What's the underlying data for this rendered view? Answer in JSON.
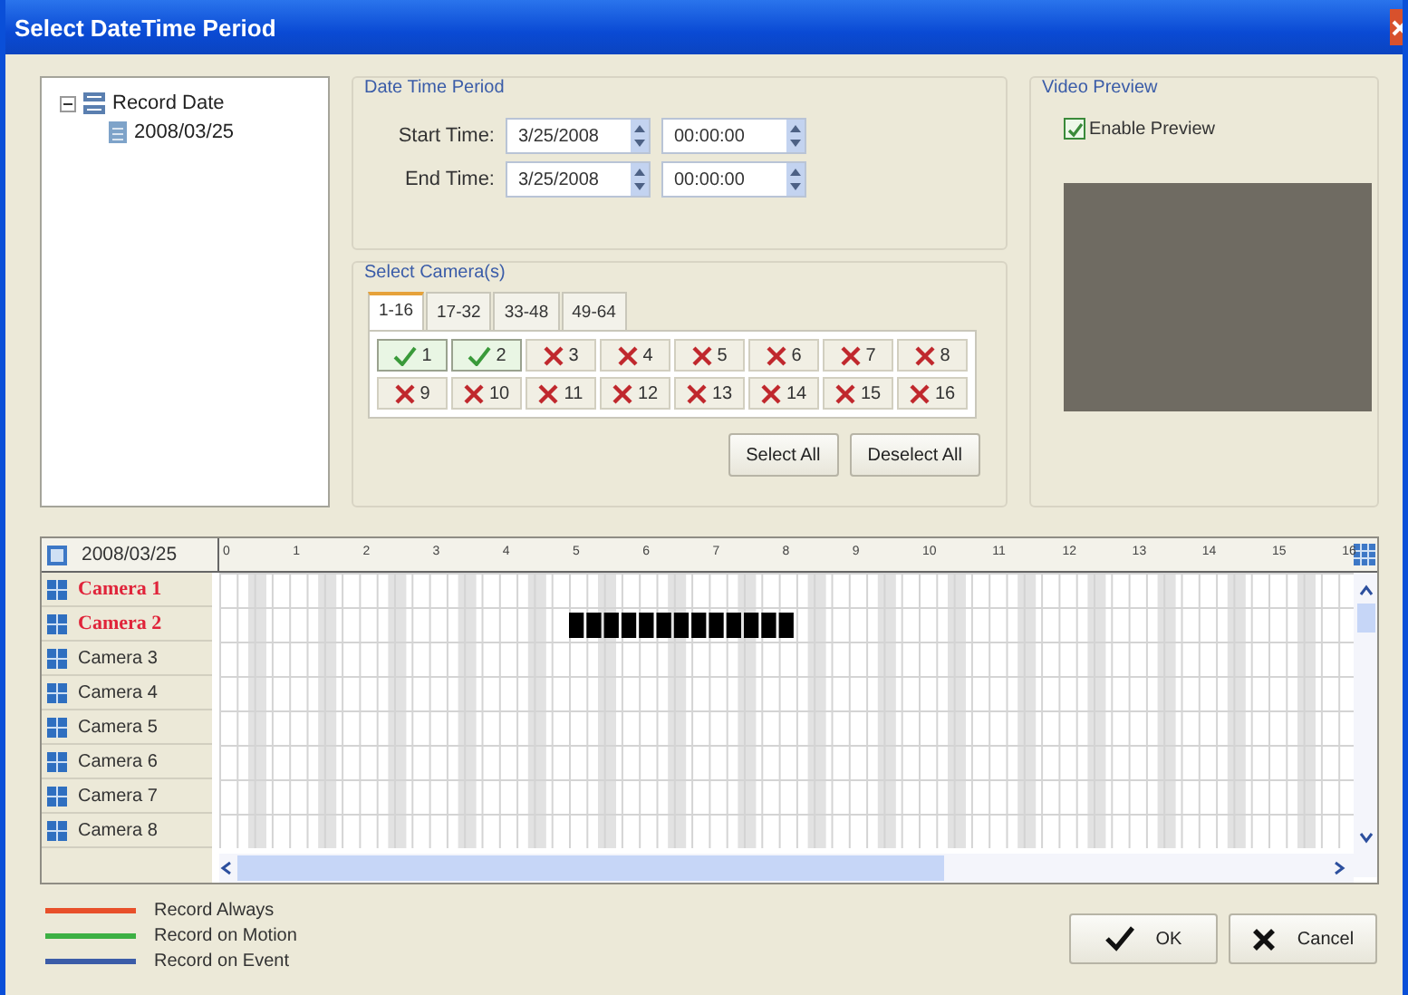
{
  "window": {
    "title": "Select DateTime Period"
  },
  "tree": {
    "label": "Record Date",
    "expanded": true,
    "children": [
      {
        "label": "2008/03/25"
      }
    ]
  },
  "date_time_period": {
    "title": "Date Time Period",
    "rows": [
      {
        "label": "Start Time:",
        "date": "3/25/2008",
        "time": "00:00:00"
      },
      {
        "label": "End Time:",
        "date": "3/25/2008",
        "time": "00:00:00"
      }
    ]
  },
  "camera_select": {
    "title": "Select Camera(s)",
    "tabs": [
      {
        "label": "1-16",
        "selected": true
      },
      {
        "label": "17-32",
        "selected": false
      },
      {
        "label": "33-48",
        "selected": false
      },
      {
        "label": "49-64",
        "selected": false
      }
    ],
    "cameras": [
      {
        "label": "1",
        "checked": true
      },
      {
        "label": "2",
        "checked": true
      },
      {
        "label": "3",
        "checked": false
      },
      {
        "label": "4",
        "checked": false
      },
      {
        "label": "5",
        "checked": false
      },
      {
        "label": "6",
        "checked": false
      },
      {
        "label": "7",
        "checked": false
      },
      {
        "label": "8",
        "checked": false
      },
      {
        "label": "9",
        "checked": false
      },
      {
        "label": "10",
        "checked": false
      },
      {
        "label": "11",
        "checked": false
      },
      {
        "label": "12",
        "checked": false
      },
      {
        "label": "13",
        "checked": false
      },
      {
        "label": "14",
        "checked": false
      },
      {
        "label": "15",
        "checked": false
      },
      {
        "label": "16",
        "checked": false
      }
    ],
    "buttons": [
      "Select All",
      "Deselect All"
    ]
  },
  "video_preview": {
    "title": "Video Preview",
    "enable_preview": {
      "label": "Enable Preview",
      "checked": true
    }
  },
  "timeline": {
    "date": "2008/03/25",
    "hours": [
      "0",
      "1",
      "2",
      "3",
      "4",
      "5",
      "6",
      "7",
      "8",
      "9",
      "10",
      "11",
      "12",
      "13",
      "14",
      "15",
      "16"
    ],
    "cameras": [
      {
        "name": "Camera 1",
        "selected": true,
        "recorded": false
      },
      {
        "name": "Camera 2",
        "selected": true,
        "recorded": true
      },
      {
        "name": "Camera 3",
        "selected": false,
        "recorded": false
      },
      {
        "name": "Camera 4",
        "selected": false,
        "recorded": false
      },
      {
        "name": "Camera 5",
        "selected": false,
        "recorded": false
      },
      {
        "name": "Camera 6",
        "selected": false,
        "recorded": false
      },
      {
        "name": "Camera 7",
        "selected": false,
        "recorded": false
      },
      {
        "name": "Camera 8",
        "selected": false,
        "recorded": false
      }
    ]
  },
  "legend": [
    {
      "label": "Record Always",
      "color": "#e8502a"
    },
    {
      "label": "Record on Motion",
      "color": "#3cb043"
    },
    {
      "label": "Record on Event",
      "color": "#3b5ca8"
    }
  ],
  "buttons": [
    {
      "label": "OK",
      "kind": "ok"
    },
    {
      "label": "Cancel",
      "kind": "cancel"
    }
  ]
}
